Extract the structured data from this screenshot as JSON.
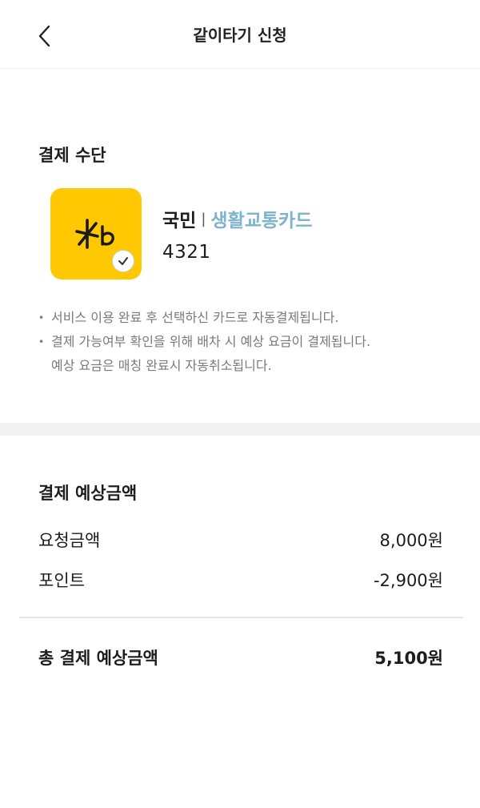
{
  "header": {
    "title": "같이타기 신청",
    "back_icon": "chevron-left-icon"
  },
  "payment": {
    "section_title": "결제 수단",
    "card": {
      "logo_icon": "kb-logo-icon",
      "bank": "국민",
      "separator": "|",
      "product": "생활교통카드",
      "number": "4321",
      "selected": true,
      "brand_color": "#FFC800",
      "product_color": "#7EB3CC"
    },
    "notes": [
      "서비스 이용 완료 후 선택하신 카드로 자동결제됩니다.",
      "결제 가능여부 확인을 위해 배차 시 예상 요금이 결제됩니다."
    ],
    "note_continuation": "예상 요금은 매칭 완료시 자동취소됩니다."
  },
  "fare": {
    "section_title": "결제 예상금액",
    "rows": [
      {
        "label": "요청금액",
        "value": "8,000원"
      },
      {
        "label": "포인트",
        "value": "-2,900원"
      }
    ],
    "total": {
      "label": "총 결제 예상금액",
      "value": "5,100원"
    }
  }
}
